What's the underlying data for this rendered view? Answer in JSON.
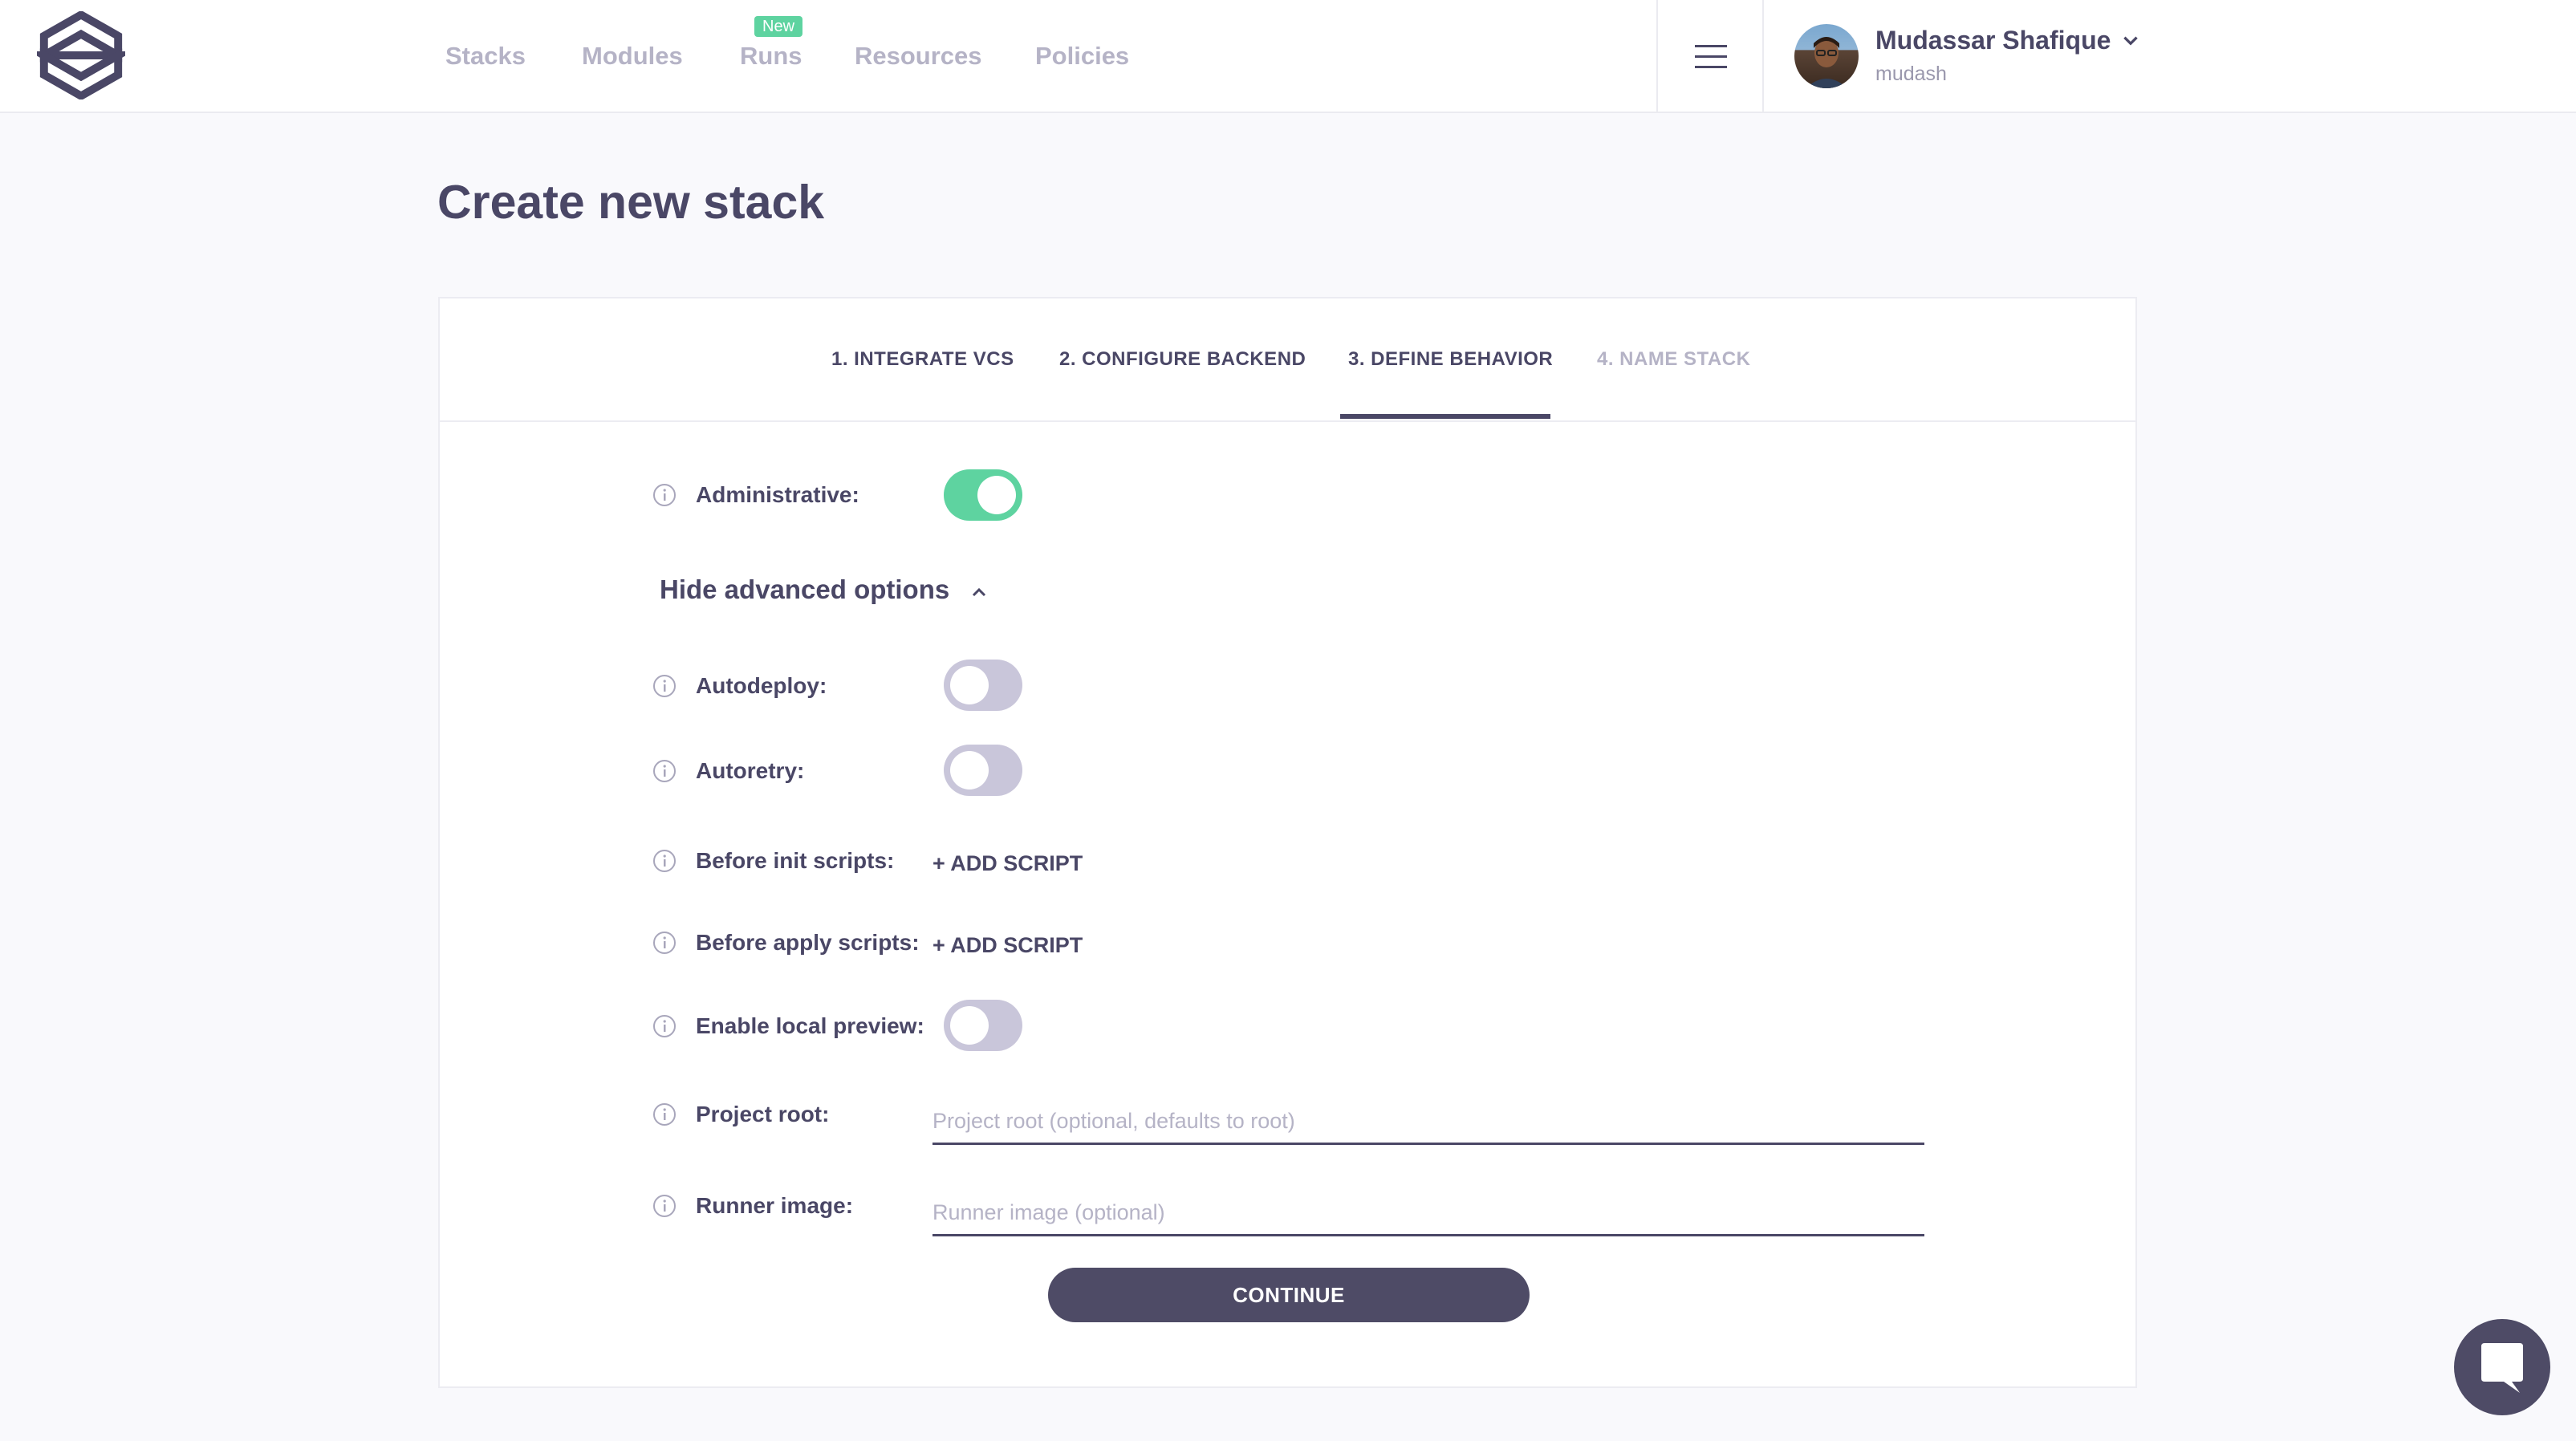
{
  "nav": {
    "items": [
      {
        "label": "Stacks"
      },
      {
        "label": "Modules"
      },
      {
        "label": "Runs",
        "badge": "New"
      },
      {
        "label": "Resources"
      },
      {
        "label": "Policies"
      }
    ]
  },
  "user": {
    "name": "Mudassar Shafique",
    "login": "mudash"
  },
  "page": {
    "title": "Create new stack"
  },
  "steps": [
    {
      "label": "1. INTEGRATE VCS",
      "state": "done"
    },
    {
      "label": "2. CONFIGURE BACKEND",
      "state": "done"
    },
    {
      "label": "3. DEFINE BEHAVIOR",
      "state": "active"
    },
    {
      "label": "4. NAME STACK",
      "state": "disabled"
    }
  ],
  "form": {
    "administrative": {
      "label": "Administrative:",
      "enabled": true
    },
    "advanced_toggle": "Hide advanced options",
    "autodeploy": {
      "label": "Autodeploy:",
      "enabled": false
    },
    "autoretry": {
      "label": "Autoretry:",
      "enabled": false
    },
    "before_init": {
      "label": "Before init scripts:",
      "action": "+ ADD SCRIPT"
    },
    "before_apply": {
      "label": "Before apply scripts:",
      "action": "+ ADD SCRIPT"
    },
    "local_preview": {
      "label": "Enable local preview:",
      "enabled": false
    },
    "project_root": {
      "label": "Project root:",
      "placeholder": "Project root (optional, defaults to root)",
      "value": ""
    },
    "runner_image": {
      "label": "Runner image:",
      "placeholder": "Runner image (optional)",
      "value": ""
    },
    "continue_label": "CONTINUE"
  },
  "colors": {
    "accent": "#5ed3a0",
    "primary": "#4e4b66",
    "muted": "#b5b3c6",
    "toggle_off": "#c9c6da",
    "background": "#f9f9fc"
  },
  "icons": {
    "logo": "spacelift-logo",
    "menu": "hamburger-icon",
    "user_menu": "chevron-down-icon",
    "info": "info-icon",
    "collapse": "chevron-up-icon",
    "chat": "chat-icon"
  }
}
